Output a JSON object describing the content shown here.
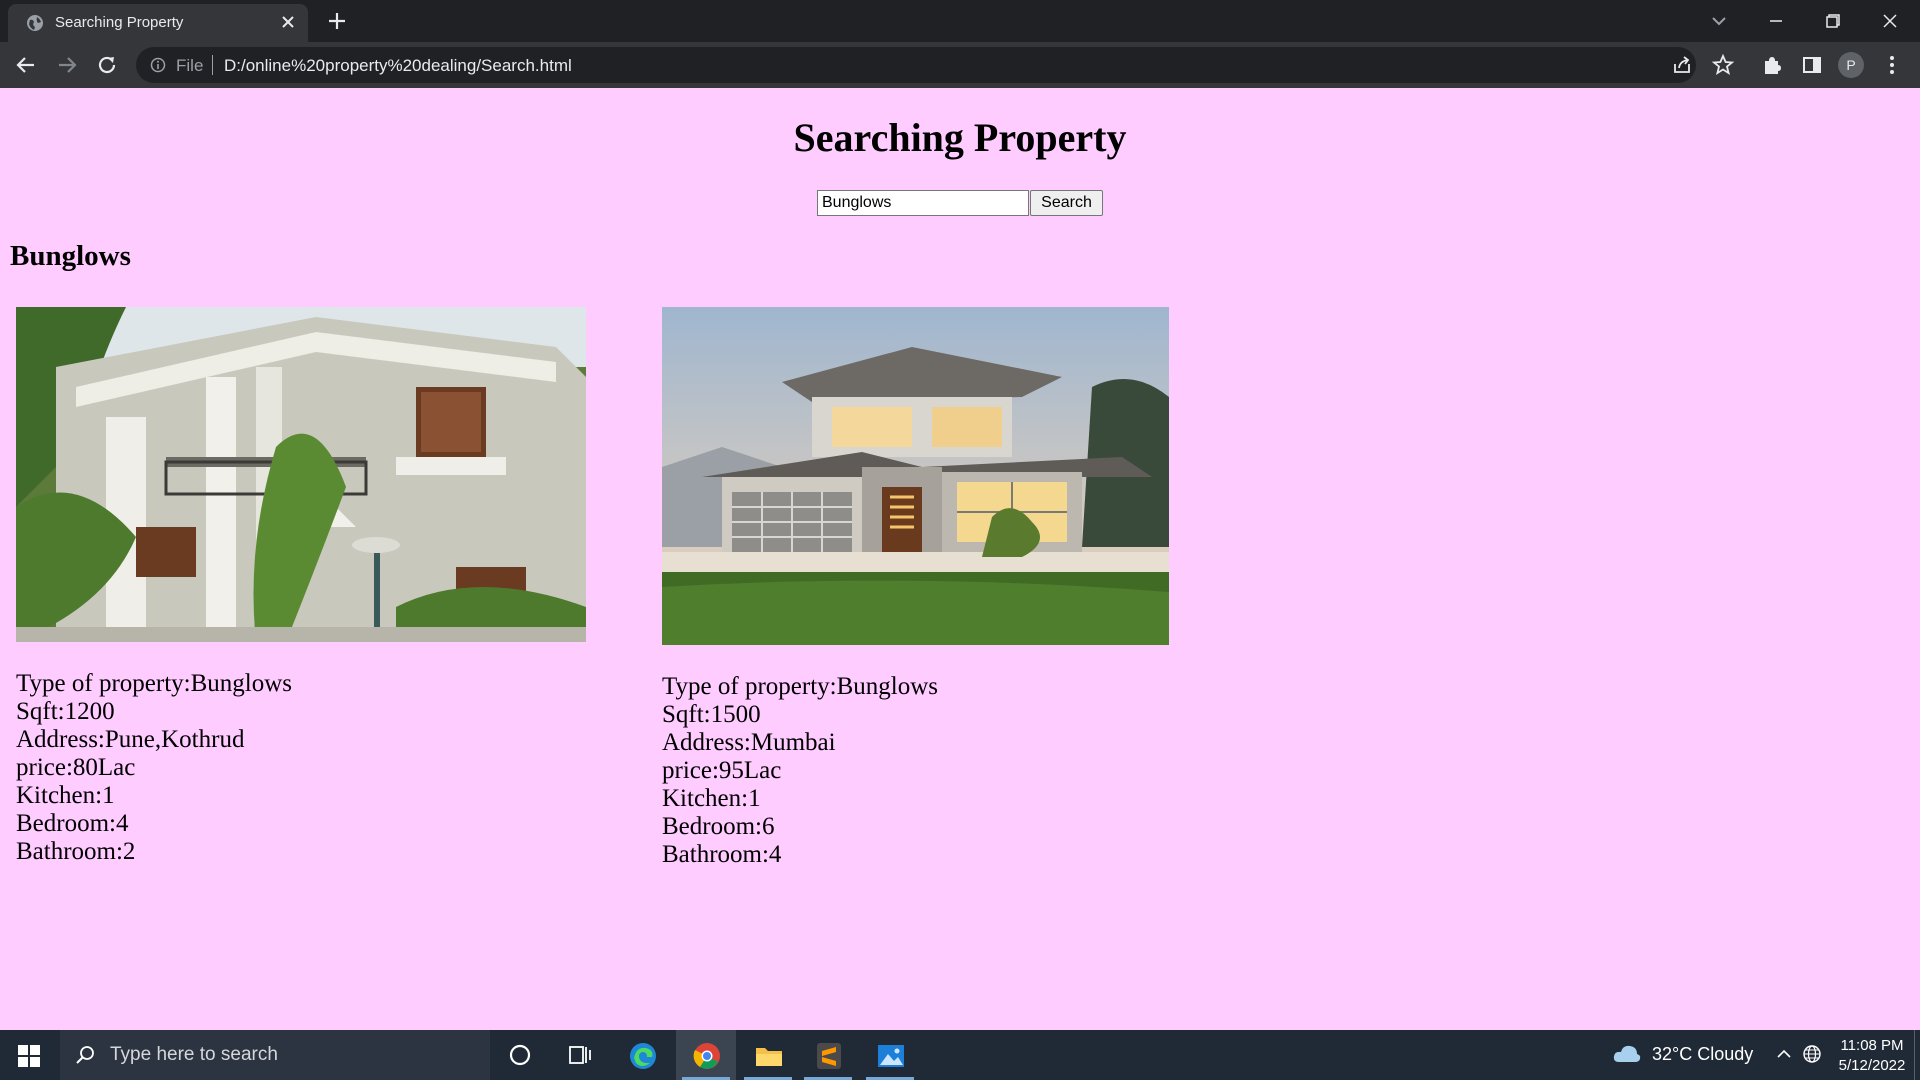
{
  "browser": {
    "tab_title": "Searching Property",
    "omnibox_scheme": "File",
    "url": "D:/online%20property%20dealing/Search.html",
    "profile_initial": "P"
  },
  "page": {
    "title": "Searching Property",
    "search": {
      "value": "Bunglows",
      "button_label": "Search"
    },
    "section_heading": "Bunglows",
    "listings": [
      {
        "type": "Type of property:Bunglows",
        "sqft": "Sqft:1200",
        "address": "Address:Pune,Kothrud",
        "price": "price:80Lac",
        "kitchen": "Kitchen:1",
        "bedroom": "Bedroom:4",
        "bathroom": "Bathroom:2"
      },
      {
        "type": "Type of property:Bunglows",
        "sqft": "Sqft:1500",
        "address": "Address:Mumbai",
        "price": "price:95Lac",
        "kitchen": "Kitchen:1",
        "bedroom": "Bedroom:6",
        "bathroom": "Bathroom:4"
      }
    ]
  },
  "taskbar": {
    "search_placeholder": "Type here to search",
    "weather": "32°C  Cloudy",
    "time": "11:08 PM",
    "date": "5/12/2022"
  },
  "colors": {
    "page_background": "#ffccff",
    "chrome_dark": "#202124",
    "toolbar": "#35363a",
    "taskbar": "#202a36"
  }
}
